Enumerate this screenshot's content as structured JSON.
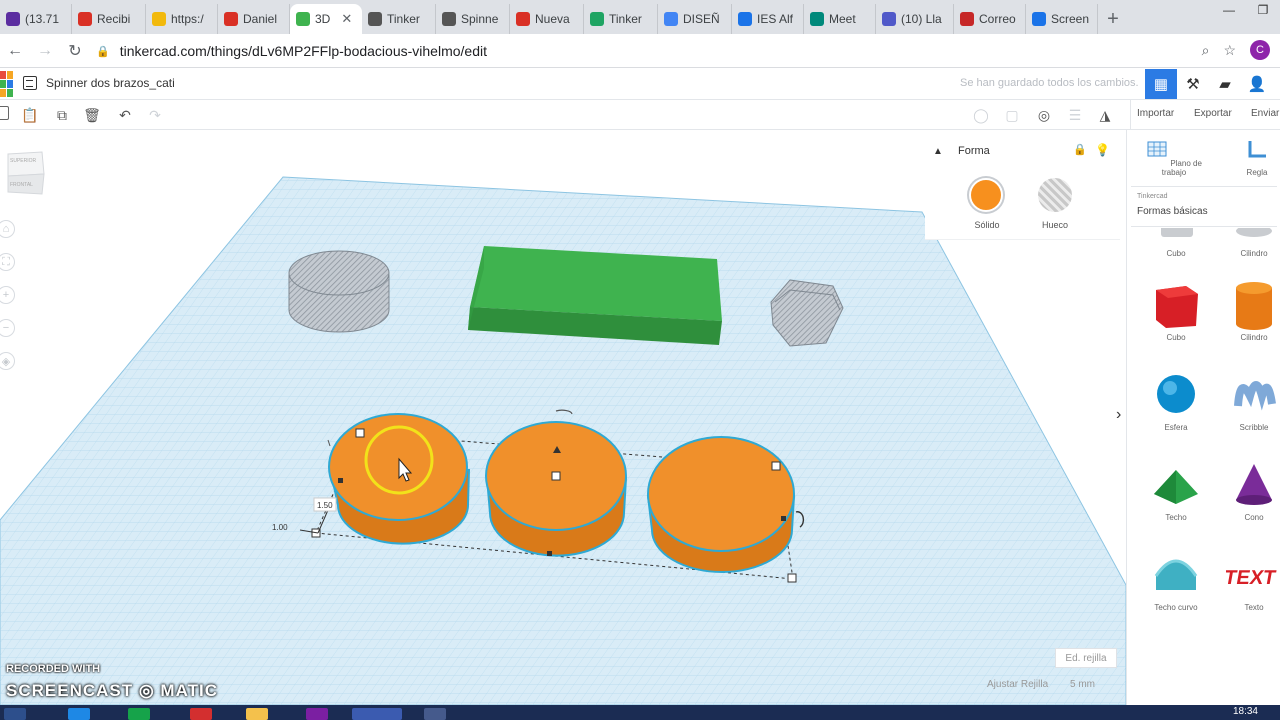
{
  "browser": {
    "tabs": [
      {
        "title": "(13.71",
        "favicon": "mail",
        "color": "#5b2da0"
      },
      {
        "title": "Recibi",
        "favicon": "gmail",
        "color": "#d93025"
      },
      {
        "title": "https:/",
        "favicon": "e",
        "color": "#f2b90c"
      },
      {
        "title": "Daniel",
        "favicon": "gmail",
        "color": "#d93025"
      },
      {
        "title": "3D",
        "favicon": "tinkercad",
        "color": "#3fb34f",
        "active": true
      },
      {
        "title": "Tinker",
        "favicon": "gear",
        "color": "#555555"
      },
      {
        "title": "Spinne",
        "favicon": "gear",
        "color": "#555555"
      },
      {
        "title": "Nueva",
        "favicon": "gmail",
        "color": "#d93025"
      },
      {
        "title": "Tinker",
        "favicon": "drive",
        "color": "#1fa463"
      },
      {
        "title": "DISEÑ",
        "favicon": "docs",
        "color": "#4285f4"
      },
      {
        "title": "IES Alf",
        "favicon": "calendar",
        "color": "#1a73e8"
      },
      {
        "title": "Meet",
        "favicon": "meet",
        "color": "#00897b"
      },
      {
        "title": "(10) Lla",
        "favicon": "teams",
        "color": "#5059c9"
      },
      {
        "title": "Correo",
        "favicon": "mail",
        "color": "#c62828"
      },
      {
        "title": "Screen",
        "favicon": "screencast",
        "color": "#1a73e8"
      }
    ],
    "tab_close": "✕",
    "new_tab": "+",
    "window_controls": {
      "minimize": "—",
      "restore": "❐",
      "close": "✕"
    },
    "url": "tinkercad.com/things/dLv6MP2FFlp-bodacious-vihelmo/edit",
    "profile_initial": "C"
  },
  "app": {
    "design_title": "Spinner dos brazos_cati",
    "save_status": "Se han guardado todos los cambios.",
    "top_actions": {
      "import": "Importar",
      "export": "Exportar",
      "send": "Enviar"
    },
    "inspector": {
      "title": "Forma",
      "solid_label": "Sólido",
      "hole_label": "Hueco",
      "solid_color": "#f7901e"
    },
    "panel": {
      "workplane_label": "Plano de trabajo",
      "ruler_label": "Regla",
      "source": "Tinkercad",
      "library": "Formas básicas",
      "shapes": [
        "Cubo",
        "Cilindro",
        "Cubo",
        "Cilindro",
        "Esfera",
        "Scribble",
        "Techo",
        "Cono",
        "Techo curvo",
        "Texto"
      ]
    },
    "workplane": {
      "dim_a": "1.50",
      "dim_b": "1.00"
    },
    "grid": {
      "edit_label": "Ed. rejilla",
      "snap_label": "Ajustar Rejilla",
      "snap_value": "5 mm"
    },
    "viewcube": {
      "top": "SUPERIOR",
      "front": "FRONTAL"
    },
    "collapse_icon": "›"
  },
  "watermark": {
    "line1": "RECORDED WITH",
    "line2": "SCREENCAST ◎ MATIC"
  },
  "taskbar": {
    "time": "18:34"
  }
}
